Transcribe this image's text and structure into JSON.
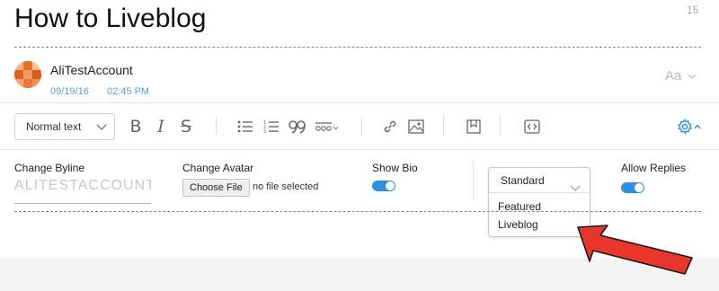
{
  "post": {
    "title": "How to Liveblog",
    "char_count": "15"
  },
  "author": {
    "name": "AliTestAccount",
    "date": "09/19/16",
    "time": "02:45 PM"
  },
  "font_menu": {
    "label": "Aa"
  },
  "toolbar": {
    "text_style": "Normal text",
    "bold": "B",
    "italic": "I",
    "strike": "S"
  },
  "settings": {
    "byline": {
      "label": "Change Byline",
      "value": "ALITESTACCOUNT"
    },
    "avatar": {
      "label": "Change Avatar",
      "button": "Choose File",
      "status": "no file selected"
    },
    "show_bio": {
      "label": "Show Bio",
      "on": true
    },
    "post_type": {
      "selected": "Standard",
      "options": [
        "Featured",
        "Liveblog"
      ]
    },
    "allow_replies": {
      "label": "Allow Replies",
      "on": true
    }
  },
  "colors": {
    "accent": "#2f8fe0",
    "meta_text": "#5aa0d8",
    "arrow": "#e8362a"
  },
  "icons": [
    "chevron-down-icon",
    "bullet-list-icon",
    "numbered-list-icon",
    "quote-icon",
    "more-icon",
    "link-icon",
    "image-icon",
    "bookmark-icon",
    "code-icon",
    "gear-icon"
  ]
}
